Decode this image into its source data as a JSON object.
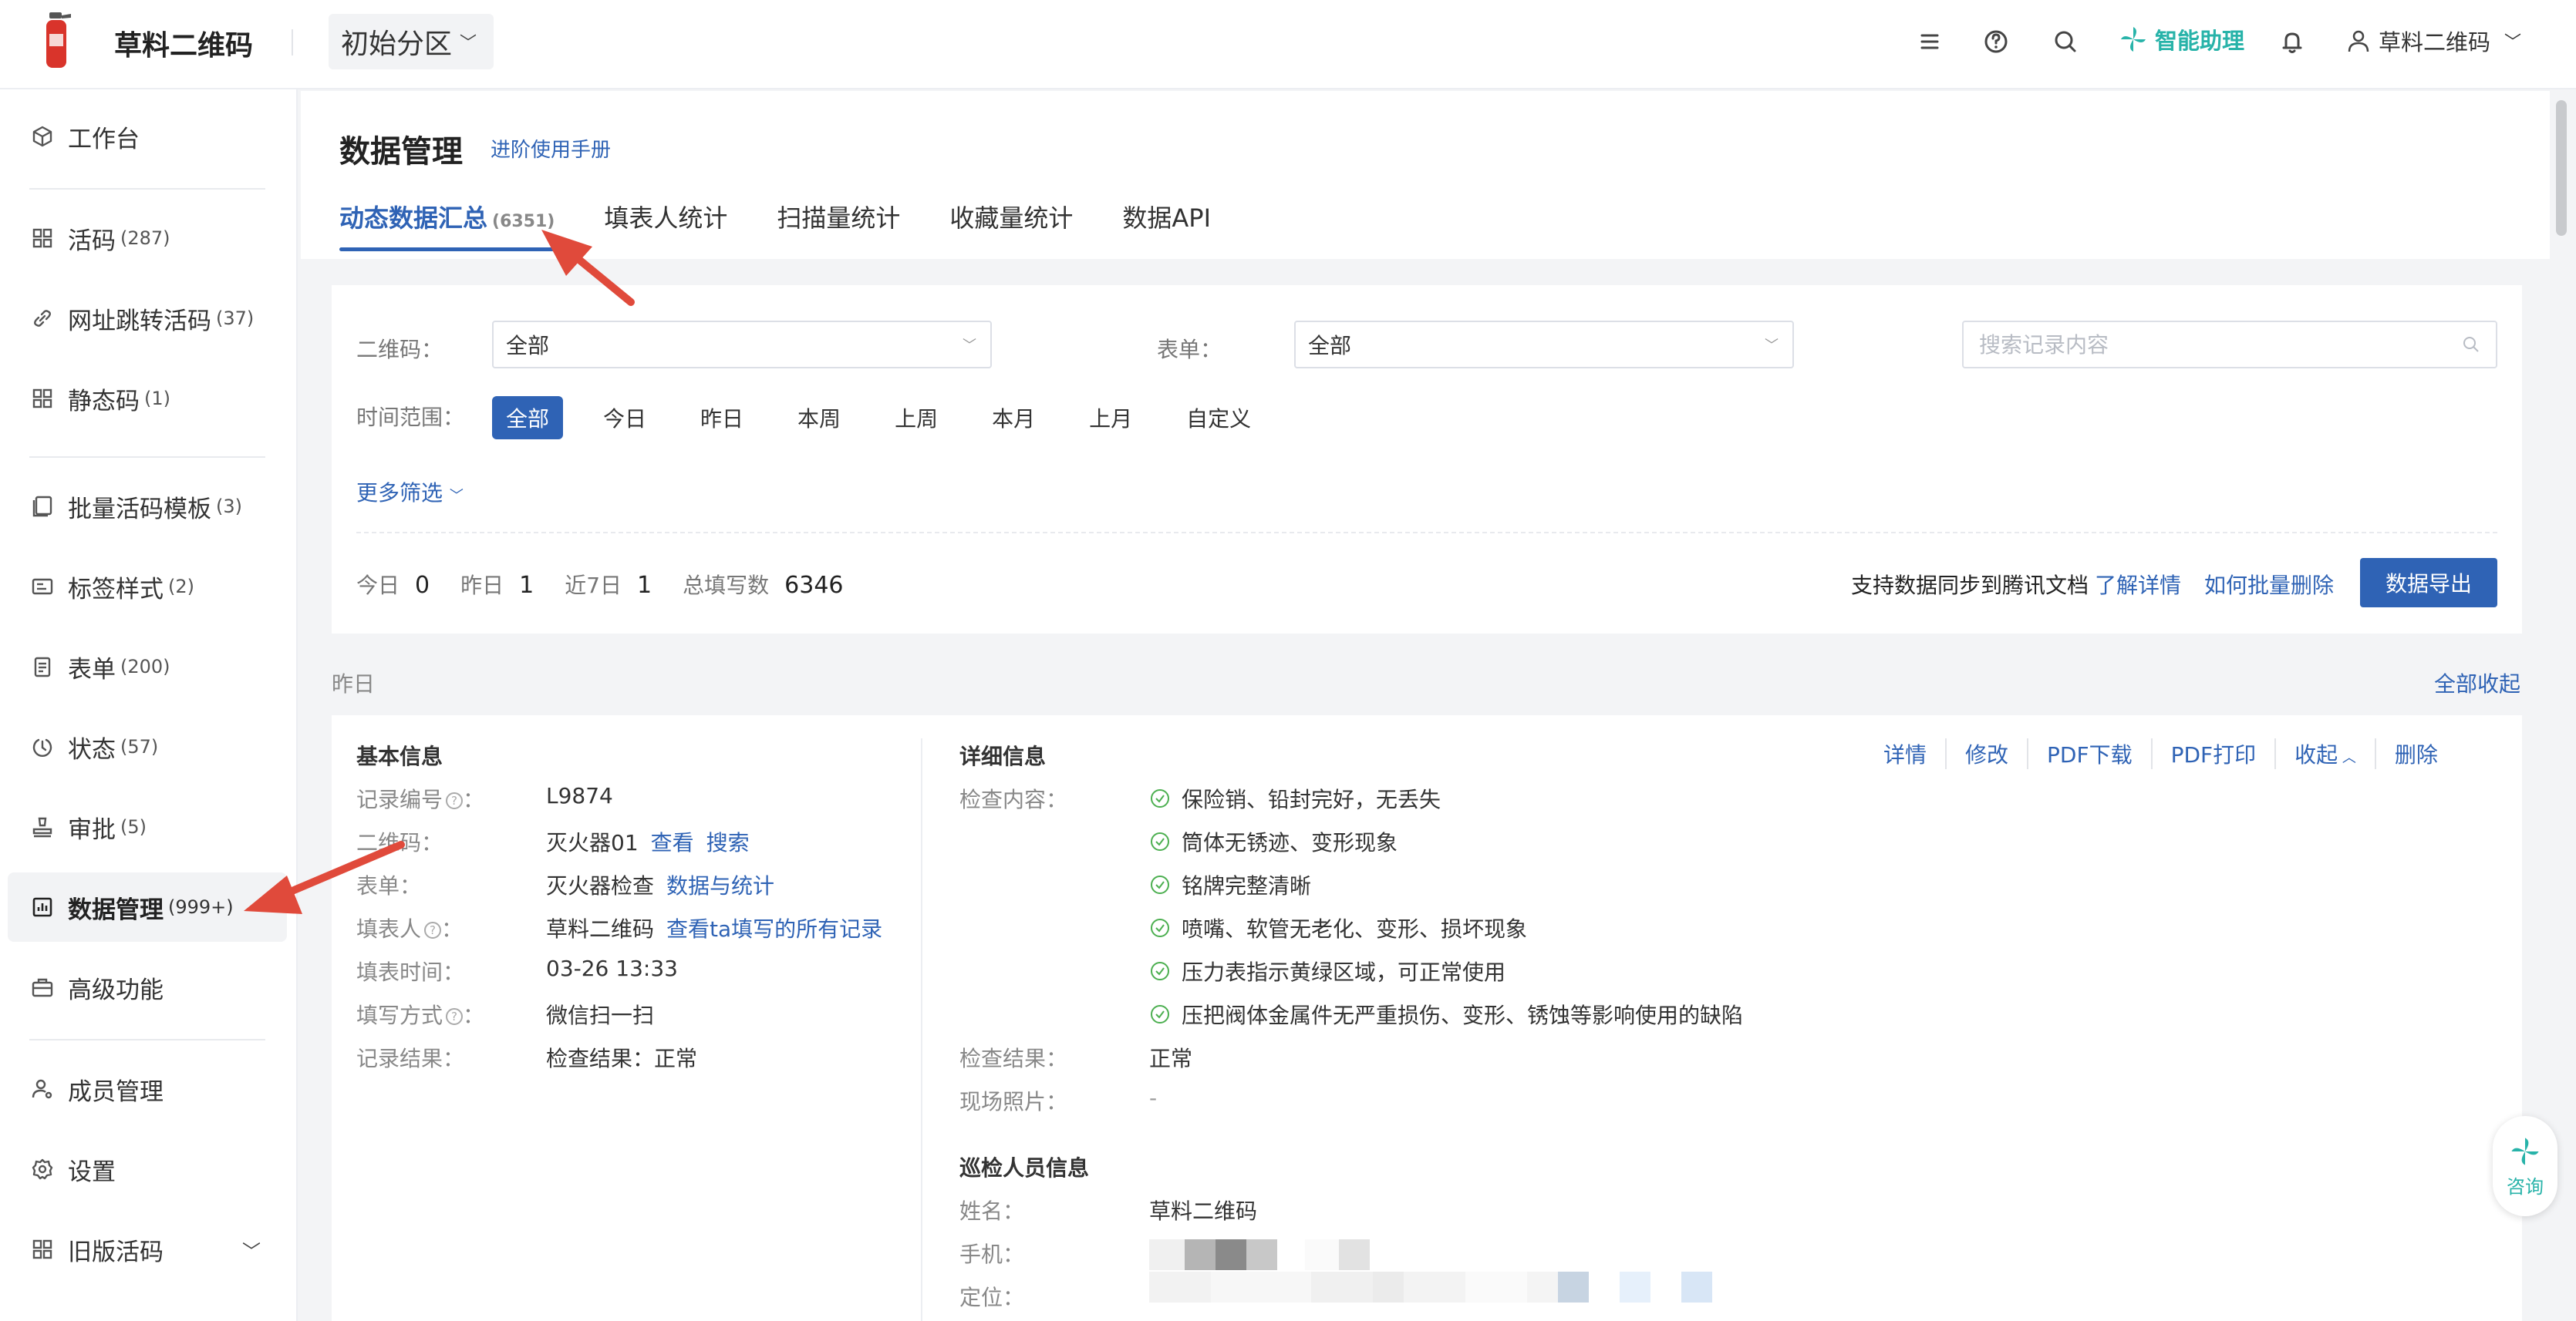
{
  "app": {
    "brand": "草料二维码",
    "partition": "初始分区",
    "assistant_label": "智能助理",
    "user_name": "草料二维码"
  },
  "sidebar": {
    "items": [
      {
        "label": "工作台",
        "count": "",
        "icon": "cube-icon"
      },
      {
        "label": "活码",
        "count": "(287)",
        "icon": "qr-grid-icon"
      },
      {
        "label": "网址跳转活码",
        "count": "(37)",
        "icon": "link-icon"
      },
      {
        "label": "静态码",
        "count": "(1)",
        "icon": "qr-grid-icon"
      },
      {
        "label": "批量活码模板",
        "count": "(3)",
        "icon": "template-icon"
      },
      {
        "label": "标签样式",
        "count": "(2)",
        "icon": "label-icon"
      },
      {
        "label": "表单",
        "count": "(200)",
        "icon": "form-icon"
      },
      {
        "label": "状态",
        "count": "(57)",
        "icon": "status-icon"
      },
      {
        "label": "审批",
        "count": "(5)",
        "icon": "approve-icon"
      },
      {
        "label": "数据管理",
        "count": "(999+)",
        "icon": "chart-icon"
      },
      {
        "label": "高级功能",
        "count": "",
        "icon": "briefcase-icon"
      },
      {
        "label": "成员管理",
        "count": "",
        "icon": "member-icon"
      },
      {
        "label": "设置",
        "count": "",
        "icon": "gear-icon"
      },
      {
        "label": "旧版活码",
        "count": "",
        "icon": "qr-grid-icon"
      }
    ]
  },
  "header": {
    "title": "数据管理",
    "manual_link": "进阶使用手册",
    "tabs": [
      {
        "label": "动态数据汇总",
        "count": "(6351)"
      },
      {
        "label": "填表人统计",
        "count": ""
      },
      {
        "label": "扫描量统计",
        "count": ""
      },
      {
        "label": "收藏量统计",
        "count": ""
      },
      {
        "label": "数据API",
        "count": ""
      }
    ]
  },
  "filters": {
    "qrcode_label": "二维码：",
    "qrcode_value": "全部",
    "form_label": "表单：",
    "form_value": "全部",
    "search_placeholder": "搜索记录内容",
    "time_label": "时间范围：",
    "time_options": [
      "全部",
      "今日",
      "昨日",
      "本周",
      "上周",
      "本月",
      "上月",
      "自定义"
    ],
    "more_filter": "更多筛选"
  },
  "stats": {
    "today_label": "今日",
    "today_value": "0",
    "yesterday_label": "昨日",
    "yesterday_value": "1",
    "week_label": "近7日",
    "week_value": "1",
    "total_label": "总填写数",
    "total_value": "6346",
    "sync_text": "支持数据同步到腾讯文档",
    "sync_link": "了解详情",
    "batch_delete_link": "如何批量删除",
    "export_button": "数据导出"
  },
  "day_group": {
    "label": "昨日",
    "collapse_all": "全部收起"
  },
  "record": {
    "basic_title": "基本信息",
    "basic": {
      "record_no_label": "记录编号",
      "record_no": "L9874",
      "qrcode_label": "二维码：",
      "qrcode": "灭火器01",
      "qrcode_view": "查看",
      "qrcode_search": "搜索",
      "form_label": "表单：",
      "form": "灭火器检查",
      "form_stats": "数据与统计",
      "filler_label": "填表人",
      "filler": "草料二维码",
      "filler_link": "查看ta填写的所有记录",
      "time_label": "填表时间：",
      "time": "03-26 13:33",
      "method_label": "填写方式",
      "method": "微信扫一扫",
      "result_label": "记录结果：",
      "result": "检查结果：正常"
    },
    "detail_title": "详细信息",
    "actions": [
      "详情",
      "修改",
      "PDF下载",
      "PDF打印",
      "收起",
      "删除"
    ],
    "check_label": "检查内容：",
    "check_items": [
      "保险销、铅封完好，无丢失",
      "筒体无锈迹、变形现象",
      "铭牌完整清晰",
      "喷嘴、软管无老化、变形、损坏现象",
      "压力表指示黄绿区域，可正常使用",
      "压把阀体金属件无严重损伤、变形、锈蚀等影响使用的缺陷"
    ],
    "check_result_label": "检查结果：",
    "check_result": "正常",
    "photo_label": "现场照片：",
    "photo_value": "-",
    "inspector_title": "巡检人员信息",
    "name_label": "姓名：",
    "name_value": "草料二维码",
    "phone_label": "手机：",
    "location_label": "定位："
  },
  "consult": {
    "label": "咨询"
  },
  "colors": {
    "accent": "#2f63b5",
    "assistant": "#28b3a9",
    "check_green": "#4caf50",
    "annotation_arrow": "#e04a3b"
  }
}
